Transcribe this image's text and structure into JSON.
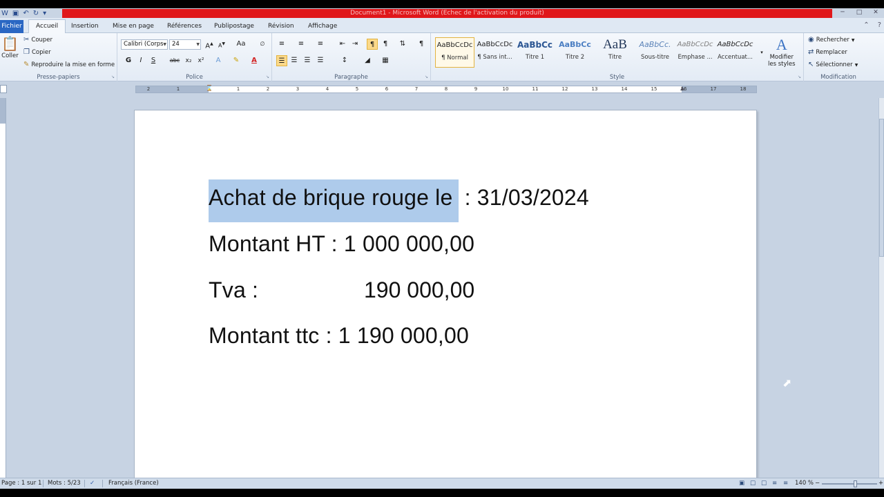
{
  "window": {
    "title": "Document1  -  Microsoft Word (Echec de l'activation du produit)"
  },
  "tabs": {
    "file": "Fichier",
    "items": [
      "Accueil",
      "Insertion",
      "Mise en page",
      "Références",
      "Publipostage",
      "Révision",
      "Affichage"
    ],
    "active": "Accueil"
  },
  "ribbon": {
    "clipboard": {
      "label": "Presse-papiers",
      "paste": "Coller",
      "cut": "Couper",
      "copy": "Copier",
      "format_painter": "Reproduire la mise en forme"
    },
    "font": {
      "label": "Police",
      "font_name": "Calibri (Corps",
      "font_size": "24",
      "bold": "G",
      "italic": "I",
      "underline": "S",
      "strike": "abc",
      "aa": "Aa"
    },
    "paragraph": {
      "label": "Paragraphe"
    },
    "styles": {
      "label": "Style",
      "items": [
        {
          "sample": "AaBbCcDc",
          "name": "¶ Normal"
        },
        {
          "sample": "AaBbCcDc",
          "name": "¶ Sans int..."
        },
        {
          "sample": "AaBbCc",
          "name": "Titre 1"
        },
        {
          "sample": "AaBbCc",
          "name": "Titre 2"
        },
        {
          "sample": "AaB",
          "name": "Titre"
        },
        {
          "sample": "AaBbCc.",
          "name": "Sous-titre"
        },
        {
          "sample": "AaBbCcDc",
          "name": "Emphase ..."
        },
        {
          "sample": "AaBbCcDc",
          "name": "Accentuat..."
        }
      ],
      "change_styles_1": "Modifier",
      "change_styles_2": "les styles"
    },
    "editing": {
      "label": "Modification",
      "find": "Rechercher",
      "replace": "Remplacer",
      "select": "Sélectionner"
    }
  },
  "ruler": {
    "ticks": [
      "2",
      "1",
      "1",
      "2",
      "3",
      "4",
      "5",
      "6",
      "7",
      "8",
      "9",
      "10",
      "11",
      "12",
      "13",
      "14",
      "15",
      "16",
      "17",
      "18"
    ]
  },
  "document": {
    "line1_selected": "Achat de brique rouge le",
    "line1_rest": " : 31/03/2024",
    "line2": "Montant HT : 1 000 000,00",
    "line3_label": "Tva :",
    "line3_value": "190 000,00",
    "line4": "Montant ttc : 1 190 000,00"
  },
  "status": {
    "page": "Page : 1 sur 1",
    "words": "Mots : 5/23",
    "language": "Français (France)",
    "zoom": "140 %"
  },
  "colors": {
    "file_tab": "#2a67c3",
    "selection": "#aecbeb",
    "title_bar_red": "#e0171a"
  }
}
